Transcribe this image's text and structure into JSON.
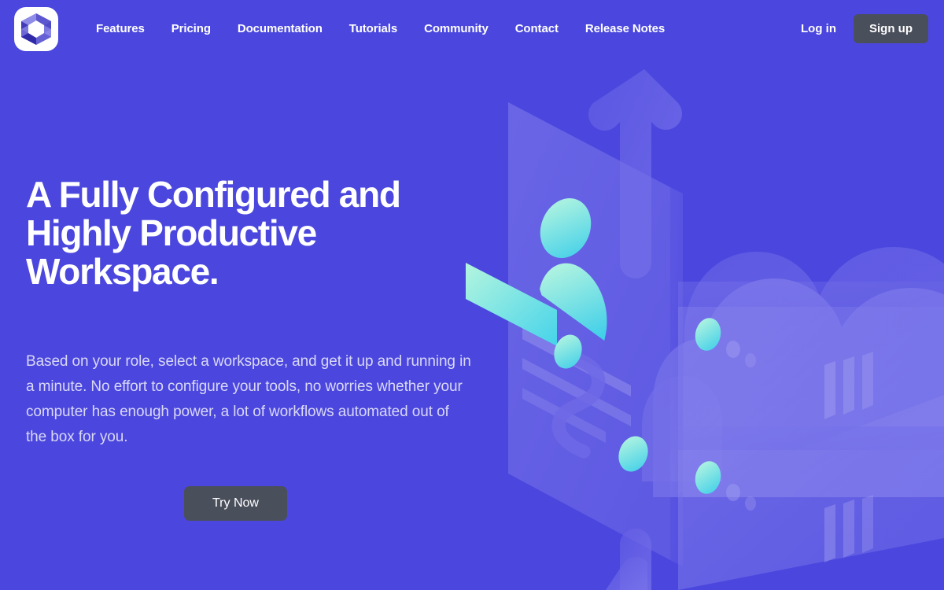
{
  "brand": {
    "logo_icon": "hexagon-prism-logo-icon",
    "logo_alt": "Workspace logo"
  },
  "nav": {
    "links": [
      {
        "label": "Features"
      },
      {
        "label": "Pricing"
      },
      {
        "label": "Documentation"
      },
      {
        "label": "Tutorials"
      },
      {
        "label": "Community"
      },
      {
        "label": "Contact"
      },
      {
        "label": "Release Notes"
      }
    ],
    "login_label": "Log in",
    "signup_label": "Sign up"
  },
  "hero": {
    "title": "A Fully Configured and Highly Productive Workspace.",
    "description": "Based on your role, select a workspace, and get it up and running in a minute. No effort to configure your tools, no worries whether your computer has enough power, a lot of workflows automated out of the box for you.",
    "cta_label": "Try Now"
  },
  "illustration": {
    "name": "isometric-cloud-workspace-illustration",
    "elements": [
      "profile-card",
      "user-avatar-glyph",
      "teal-accent-bar",
      "up-arrow",
      "down-arrow",
      "cloud-cluster",
      "server-rack-upper",
      "server-rack-lower",
      "link-connector"
    ]
  },
  "colors": {
    "background": "#4b47de",
    "button_dark": "#4a4f5c",
    "text_primary": "#ffffff",
    "text_muted": "#d9d8f5",
    "accent_mint": "#a9f2dc",
    "accent_cyan": "#4ed7e9",
    "illustration_light": "#8a86ec",
    "illustration_mid": "#6f6ae6",
    "illustration_dark": "#5a55e2"
  }
}
